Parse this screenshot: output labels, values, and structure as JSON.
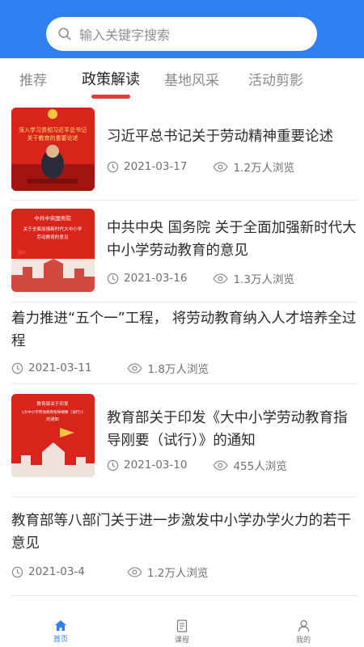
{
  "search": {
    "placeholder": "输入关键字搜索"
  },
  "tabs": [
    {
      "label": "推荐"
    },
    {
      "label": "政策解读"
    },
    {
      "label": "基地风采"
    },
    {
      "label": "活动剪影"
    }
  ],
  "articles": [
    {
      "title": "习近平总书记关于劳动精神重要论述",
      "date": "2021-03-17",
      "views": "1.2万人浏览",
      "thumb_text": [
        "深入学习贯彻习近平总书记",
        "关于教育的重要论述"
      ]
    },
    {
      "title": "中共中央 国务院 关于全面加强新时代大中小学劳动教育的意见",
      "date": "2021-03-16",
      "views": "1.3万人浏览",
      "thumb_text": [
        "中共中央国务院",
        "关于全面加强新时代大中小学",
        "劳动教育的意见"
      ]
    },
    {
      "title": "着力推进“五个一”工程， 将劳动教育纳入人才培养全过程",
      "date": "2021-03-11",
      "views": "1.8万人浏览"
    },
    {
      "title": "教育部关于印发《大中小学劳动教育指导刚要（试行）》的通知",
      "date": "2021-03-10",
      "views": "455人浏览",
      "thumb_text": [
        "教育部关于印发",
        "《大中小学劳动教育指导纲要（试行）》",
        "的通知"
      ]
    },
    {
      "title": "教育部等八部门关于进一步激发中小学办学火力的若干意见",
      "date": "2021-03-4",
      "views": "1.2万人浏览"
    }
  ],
  "bottom_nav": [
    {
      "label": "首页",
      "icon": "home-icon"
    },
    {
      "label": "课程",
      "icon": "document-icon"
    },
    {
      "label": "我的",
      "icon": "user-icon"
    }
  ],
  "colors": {
    "header": "#2f7ff0",
    "tab_indicator": "#e8393a",
    "thumb_red": "#d9241c"
  }
}
